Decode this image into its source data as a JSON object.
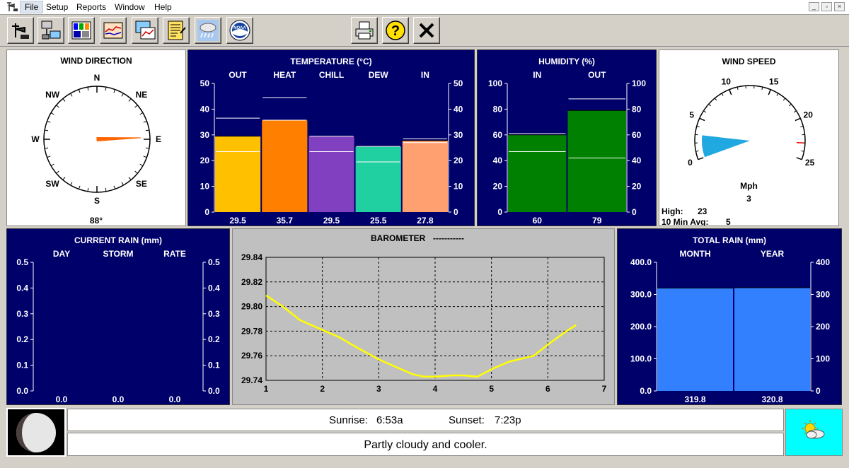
{
  "menu": {
    "file": "File",
    "setup": "Setup",
    "reports": "Reports",
    "window": "Window",
    "help": "Help"
  },
  "toolbar": {
    "buttons": [
      {
        "icon": "wind-vane-icon"
      },
      {
        "icon": "data-transfer-icon"
      },
      {
        "icon": "station-console-icon"
      },
      {
        "icon": "graph-icon"
      },
      {
        "icon": "multi-graph-icon"
      },
      {
        "icon": "notes-icon"
      },
      {
        "icon": "rain-cloud-icon"
      },
      {
        "icon": "noaa-icon"
      },
      {
        "icon": "printer-icon"
      },
      {
        "icon": "help-icon"
      },
      {
        "icon": "close-icon"
      }
    ],
    "noaa_text": "NOAA"
  },
  "wind_direction": {
    "title": "WIND DIRECTION",
    "points": [
      "N",
      "NE",
      "E",
      "SE",
      "S",
      "SW",
      "W",
      "NW"
    ],
    "degrees": 88,
    "value": "88°"
  },
  "temperature": {
    "title": "TEMPERATURE  (°C)",
    "categories": [
      "OUT",
      "HEAT",
      "CHILL",
      "DEW",
      "IN"
    ],
    "values": [
      "29.5",
      "35.7",
      "29.5",
      "25.5",
      "27.8"
    ],
    "ticks": [
      "50",
      "40",
      "30",
      "20",
      "10",
      "0"
    ]
  },
  "humidity": {
    "title": "HUMIDITY  (%)",
    "categories": [
      "IN",
      "OUT"
    ],
    "values": [
      "60",
      "79"
    ],
    "ticks": [
      "100",
      "80",
      "60",
      "40",
      "20",
      "0"
    ]
  },
  "wind_speed": {
    "title": "WIND SPEED",
    "dial_ticks": [
      "0",
      "5",
      "10",
      "15",
      "20",
      "25"
    ],
    "unit": "Mph",
    "current": "3",
    "current_value": 3,
    "high_label": "High:",
    "high_value": "23",
    "avg_label": "10 Min Avg:",
    "avg_value": "5"
  },
  "current_rain": {
    "title": "CURRENT RAIN  (mm)",
    "categories": [
      "DAY",
      "STORM",
      "RATE"
    ],
    "values": [
      "0.0",
      "0.0",
      "0.0"
    ],
    "ticks": [
      "0.5",
      "0.4",
      "0.3",
      "0.2",
      "0.1",
      "0.0"
    ]
  },
  "barometer": {
    "title": "BAROMETER",
    "trend": "-----------",
    "y_ticks": [
      "29.84",
      "29.82",
      "29.80",
      "29.78",
      "29.76",
      "29.74"
    ],
    "x_ticks": [
      "1",
      "2",
      "3",
      "4",
      "5",
      "6",
      "7"
    ]
  },
  "total_rain": {
    "title": "TOTAL RAIN  (mm)",
    "categories": [
      "MONTH",
      "YEAR"
    ],
    "values": [
      "319.8",
      "320.8"
    ],
    "ticks": [
      "400.0",
      "300.0",
      "200.0",
      "100.0",
      "0.0"
    ],
    "ticks_right": [
      "400",
      "300",
      "200",
      "100",
      "0"
    ]
  },
  "sun": {
    "sunrise_label": "Sunrise:",
    "sunrise": "6:53a",
    "sunset_label": "Sunset:",
    "sunset": "7:23p"
  },
  "forecast": "Partly cloudy and cooler.",
  "colors": {
    "navy": "#00006b",
    "temp_out": "#ffc000",
    "temp_heat": "#ff8000",
    "temp_chill": "#8040c0",
    "temp_dew": "#20d0a0",
    "temp_in": "#ffa070",
    "humidity": "#008000",
    "total_rain": "#3380ff",
    "barometer_line": "#ffff00",
    "wind_needle": "#ff6600",
    "wind_dial_fill": "#20a8e0",
    "forecast_bg": "#00ffff"
  },
  "chart_data": [
    {
      "type": "bar",
      "title": "TEMPERATURE  (°C)",
      "categories": [
        "OUT",
        "HEAT",
        "CHILL",
        "DEW",
        "IN"
      ],
      "values": [
        29.5,
        35.7,
        29.5,
        25.5,
        27.8
      ],
      "highs": [
        36.5,
        44.5,
        29.5,
        25.5,
        28.5
      ],
      "lows": [
        23.5,
        35.7,
        23.5,
        19.5,
        27.0
      ],
      "ylim": [
        0,
        50
      ]
    },
    {
      "type": "bar",
      "title": "HUMIDITY  (%)",
      "categories": [
        "IN",
        "OUT"
      ],
      "values": [
        60,
        79
      ],
      "highs": [
        61,
        88
      ],
      "lows": [
        47,
        42
      ],
      "ylim": [
        0,
        100
      ]
    },
    {
      "type": "bar",
      "title": "CURRENT RAIN  (mm)",
      "categories": [
        "DAY",
        "STORM",
        "RATE"
      ],
      "values": [
        0.0,
        0.0,
        0.0
      ],
      "ylim": [
        0,
        0.5
      ]
    },
    {
      "type": "line",
      "title": "BAROMETER",
      "x": [
        1,
        1.3,
        1.6,
        2,
        2.3,
        2.6,
        3,
        3.3,
        3.6,
        3.8,
        4,
        4.3,
        4.5,
        4.75,
        5,
        5.3,
        5.75,
        6,
        6.3,
        6.5
      ],
      "y": [
        29.809,
        29.8,
        29.789,
        29.781,
        29.775,
        29.767,
        29.757,
        29.751,
        29.745,
        29.743,
        29.743,
        29.744,
        29.744,
        29.743,
        29.749,
        29.755,
        29.76,
        29.769,
        29.779,
        29.785
      ],
      "xlim": [
        1,
        7
      ],
      "ylim": [
        29.74,
        29.84
      ],
      "grid": true
    },
    {
      "type": "bar",
      "title": "TOTAL RAIN  (mm)",
      "categories": [
        "MONTH",
        "YEAR"
      ],
      "values": [
        319.8,
        320.8
      ],
      "ylim": [
        0,
        400
      ]
    }
  ]
}
